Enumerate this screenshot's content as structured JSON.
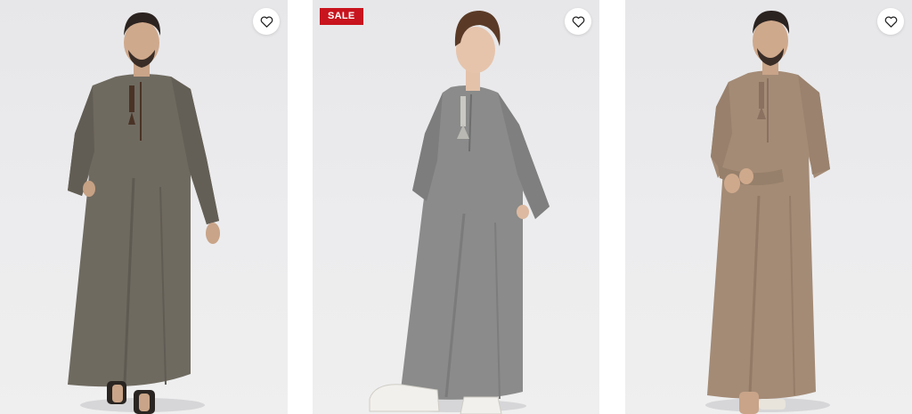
{
  "products": [
    {
      "image": "man-in-olive-grey-thobe",
      "badge": "",
      "wishlist_icon": "heart-outline-icon",
      "robe_color": "#6f6a60",
      "tassel_color": "#4a3326"
    },
    {
      "image": "boy-in-light-grey-thobe",
      "badge": "SALE",
      "badge_color": "#c8141e",
      "wishlist_icon": "heart-outline-icon",
      "robe_color": "#8a8b8a",
      "tassel_color": "#b9b8b2"
    },
    {
      "image": "man-in-tan-thobe",
      "badge": "",
      "wishlist_icon": "heart-outline-icon",
      "robe_color": "#a48b76",
      "tassel_color": "#8a7160"
    }
  ]
}
